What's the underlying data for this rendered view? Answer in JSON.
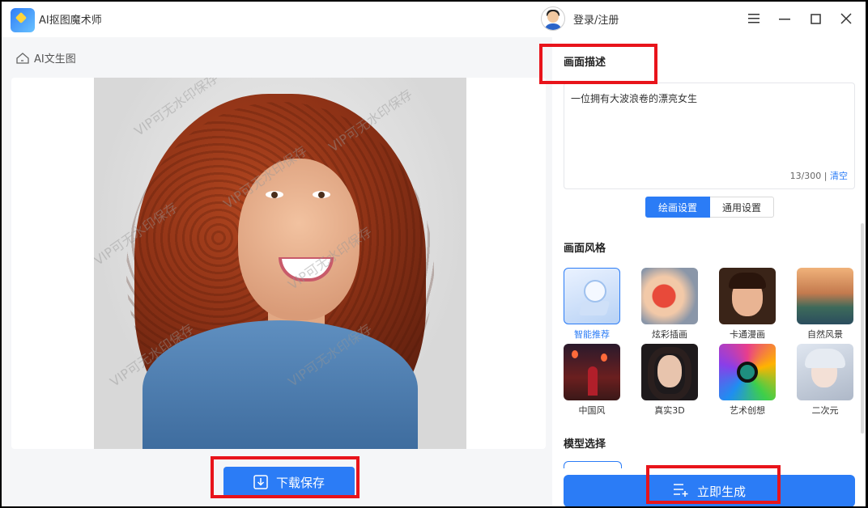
{
  "app": {
    "title": "AI抠图魔术师",
    "login_label": "登录/注册"
  },
  "window_controls": [
    "menu-icon",
    "minimize-icon",
    "maximize-icon",
    "close-icon"
  ],
  "left": {
    "back_label": "AI文生图",
    "watermark_text": "VIP可无水印保存",
    "download_label": "下载保存"
  },
  "right": {
    "description_title": "画面描述",
    "description_text": "一位拥有大波浪卷的漂亮女生",
    "char_count": "13/300",
    "clear_label": "清空",
    "tabs": [
      {
        "label": "绘画设置",
        "active": true
      },
      {
        "label": "通用设置",
        "active": false
      }
    ],
    "style_title": "画面风格",
    "styles": [
      {
        "label": "智能推荐",
        "selected": true
      },
      {
        "label": "炫彩插画",
        "selected": false
      },
      {
        "label": "卡通漫画",
        "selected": false
      },
      {
        "label": "自然风景",
        "selected": false
      },
      {
        "label": "中国风",
        "selected": false
      },
      {
        "label": "真实3D",
        "selected": false
      },
      {
        "label": "艺术创想",
        "selected": false
      },
      {
        "label": "二次元",
        "selected": false
      }
    ],
    "model_title": "模型选择",
    "generate_label": "立即生成"
  },
  "colors": {
    "accent": "#2b7cf6",
    "highlight_box": "#e8141b"
  }
}
